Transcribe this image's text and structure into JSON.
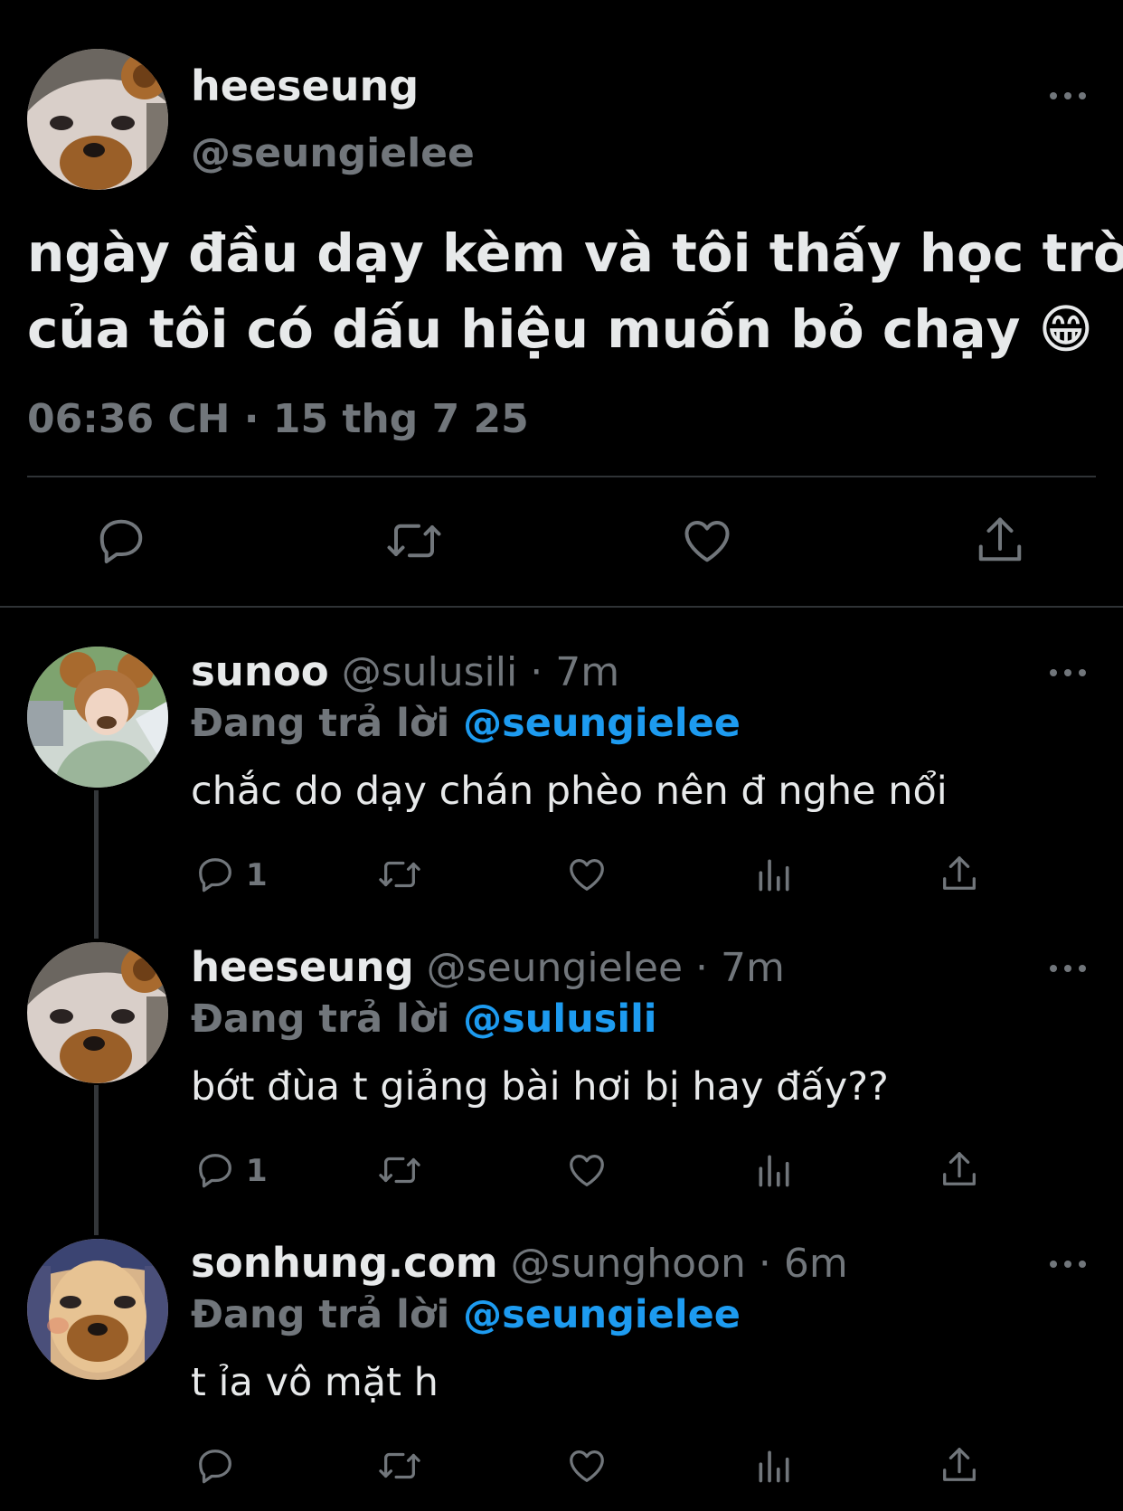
{
  "main_tweet": {
    "display_name": "heeseung",
    "handle": "@seungielee",
    "text_line1": "ngày đầu dạy kèm và tôi thấy học trò",
    "text_line2": "của tôi có dấu hiệu muốn bỏ chạy",
    "emoji": "😁",
    "timestamp": "06:36 CH · 15 thg 7 25"
  },
  "replies": [
    {
      "display_name": "sunoo",
      "handle": "@sulusili",
      "time": "· 7m",
      "replying_label": "Đang trả lời",
      "replying_to": "@seungielee",
      "text": "chắc do dạy chán phèo nên đ nghe nổi",
      "reply_count": "1"
    },
    {
      "display_name": "heeseung",
      "handle": "@seungielee",
      "time": "· 7m",
      "replying_label": "Đang trả lời",
      "replying_to": "@sulusili",
      "text": "bớt đùa t giảng bài hơi bị hay đấy??",
      "reply_count": "1"
    },
    {
      "display_name": "sonhung.com",
      "handle": "@sunghoon",
      "time": "· 6m",
      "replying_label": "Đang trả lời",
      "replying_to": "@seungielee",
      "text": "t ỉa vô mặt h",
      "reply_count": ""
    }
  ],
  "icons": {
    "reply": "comment-icon",
    "retweet": "retweet-icon",
    "like": "heart-icon",
    "share": "share-icon",
    "analytics": "analytics-icon",
    "more": "more-icon"
  },
  "colors": {
    "background": "#000000",
    "text": "#e7e9ea",
    "muted": "#71767b",
    "link": "#1d9bf0"
  }
}
